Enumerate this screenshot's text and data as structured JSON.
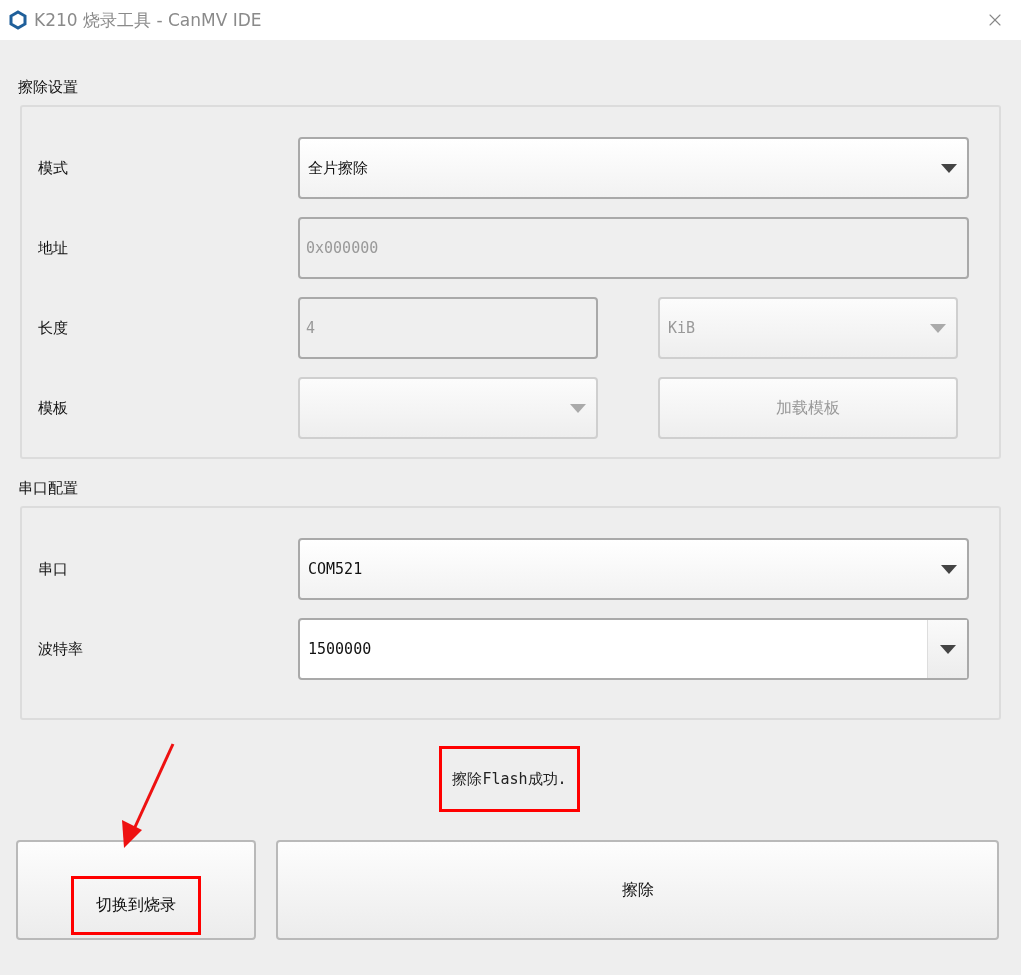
{
  "window": {
    "title": "K210 烧录工具 - CanMV IDE"
  },
  "groups": [
    {
      "title": "擦除设置",
      "rows": [
        {
          "label": "模式",
          "fields": [
            {
              "kind": "select",
              "value": "全片擦除",
              "disabled": false
            }
          ]
        },
        {
          "label": "地址",
          "fields": [
            {
              "kind": "input",
              "value": "0x000000",
              "disabled": true
            }
          ]
        },
        {
          "label": "长度",
          "fields": [
            {
              "kind": "input",
              "value": "4",
              "disabled": true
            },
            {
              "kind": "select",
              "value": "KiB",
              "disabled": true
            }
          ]
        },
        {
          "label": "模板",
          "fields": [
            {
              "kind": "select",
              "disabled": true
            },
            {
              "kind": "button",
              "value": "加载模板",
              "disabled": true
            }
          ]
        }
      ]
    },
    {
      "title": "串口配置",
      "rows": [
        {
          "label": "串口",
          "fields": [
            {
              "kind": "select",
              "value": "COM521",
              "disabled": false
            }
          ]
        },
        {
          "label": "波特率",
          "fields": [
            {
              "kind": "combo",
              "value": "1500000",
              "disabled": false
            }
          ]
        }
      ]
    }
  ],
  "status": {
    "text": "擦除Flash成功.",
    "highlighted": true
  },
  "buttons": [
    {
      "label": "切换到烧录",
      "highlighted": true,
      "arrow": true
    },
    {
      "label": "擦除",
      "highlighted": false,
      "arrow": false
    }
  ]
}
